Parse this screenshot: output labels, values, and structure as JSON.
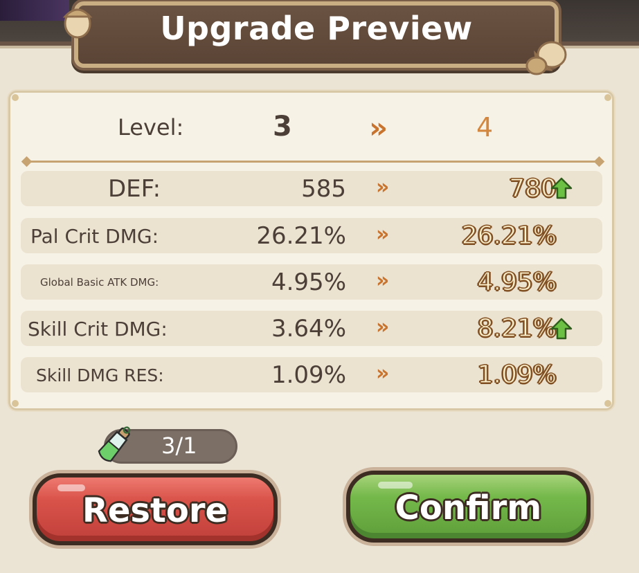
{
  "title": "Upgrade Preview",
  "level": {
    "label": "Level:",
    "from": "3",
    "arrow": "»",
    "to": "4"
  },
  "stats": [
    {
      "label": "DEF:",
      "from": "585",
      "arrow": "»",
      "to": "780",
      "increased": true
    },
    {
      "label": "Pal Crit DMG:",
      "from": "26.21%",
      "arrow": "»",
      "to": "26.21%",
      "increased": false
    },
    {
      "label": "Global Basic ATK DMG:",
      "from": "4.95%",
      "arrow": "»",
      "to": "4.95%",
      "increased": false
    },
    {
      "label": "Skill Crit DMG:",
      "from": "3.64%",
      "arrow": "»",
      "to": "8.21%",
      "increased": true
    },
    {
      "label": "Skill DMG RES:",
      "from": "1.09%",
      "arrow": "»",
      "to": "1.09%",
      "increased": false
    }
  ],
  "cost": {
    "icon": "potion-bottle-icon",
    "count": "3/1"
  },
  "buttons": {
    "restore": "Restore",
    "confirm": "Confirm"
  },
  "colors": {
    "banner": "#5b4435",
    "increase_arrow": "#5cb33a",
    "restore_button": "#d9534a",
    "confirm_button": "#74b84a",
    "arrow": "#c8742e"
  }
}
